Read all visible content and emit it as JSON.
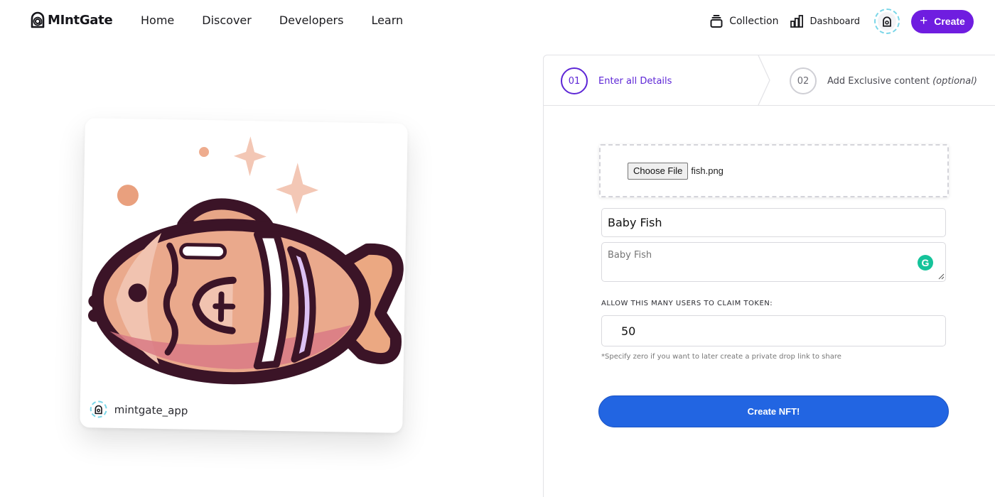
{
  "brand": {
    "name": "MIntGate"
  },
  "nav": {
    "links": [
      "Home",
      "Discover",
      "Developers",
      "Learn"
    ],
    "collection_label": "Collection",
    "dashboard_label": "Dashboard",
    "create_label": "Create"
  },
  "card": {
    "username": "mintgate_app",
    "art_icon": "fish-illustration"
  },
  "steps": [
    {
      "number": "01",
      "label": "Enter all Details",
      "optional": ""
    },
    {
      "number": "02",
      "label": "Add Exclusive content",
      "optional": "(optional)"
    }
  ],
  "form": {
    "file_button": "Choose File",
    "file_name": "fish.png",
    "name_value": "Baby Fish",
    "description_placeholder": "Baby Fish",
    "claim_label": "ALLOW THIS MANY USERS TO CLAIM TOKEN:",
    "claim_value": "50",
    "hint": "*Specify zero if you want to later create a private drop link to share",
    "submit_label": "Create NFT!"
  },
  "colors": {
    "accent_purple": "#6f1de0",
    "step_active": "#5d26d6",
    "submit_blue": "#2265e2",
    "grammarly_green": "#15c39a"
  }
}
